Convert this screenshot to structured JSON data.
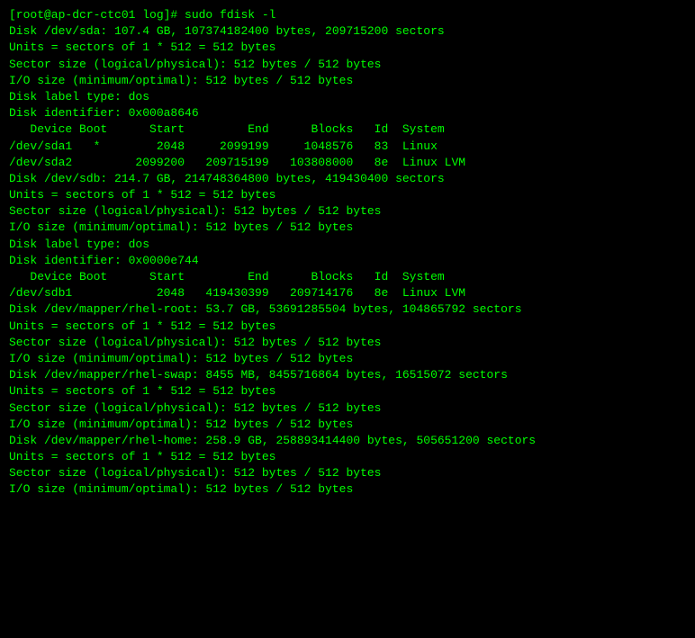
{
  "terminal": {
    "prompt": "[root@ap-dcr-ctc01 log]# sudo fdisk -l",
    "content": [
      "",
      "Disk /dev/sda: 107.4 GB, 107374182400 bytes, 209715200 sectors",
      "Units = sectors of 1 * 512 = 512 bytes",
      "Sector size (logical/physical): 512 bytes / 512 bytes",
      "I/O size (minimum/optimal): 512 bytes / 512 bytes",
      "Disk label type: dos",
      "Disk identifier: 0x000a8646",
      "",
      "   Device Boot      Start         End      Blocks   Id  System",
      "/dev/sda1   *        2048     2099199     1048576   83  Linux",
      "/dev/sda2         2099200   209715199   103808000   8e  Linux LVM",
      "",
      "Disk /dev/sdb: 214.7 GB, 214748364800 bytes, 419430400 sectors",
      "Units = sectors of 1 * 512 = 512 bytes",
      "Sector size (logical/physical): 512 bytes / 512 bytes",
      "I/O size (minimum/optimal): 512 bytes / 512 bytes",
      "Disk label type: dos",
      "Disk identifier: 0x0000e744",
      "",
      "   Device Boot      Start         End      Blocks   Id  System",
      "/dev/sdb1            2048   419430399   209714176   8e  Linux LVM",
      "",
      "Disk /dev/mapper/rhel-root: 53.7 GB, 53691285504 bytes, 104865792 sectors",
      "Units = sectors of 1 * 512 = 512 bytes",
      "Sector size (logical/physical): 512 bytes / 512 bytes",
      "I/O size (minimum/optimal): 512 bytes / 512 bytes",
      "",
      "",
      "Disk /dev/mapper/rhel-swap: 8455 MB, 8455716864 bytes, 16515072 sectors",
      "Units = sectors of 1 * 512 = 512 bytes",
      "Sector size (logical/physical): 512 bytes / 512 bytes",
      "I/O size (minimum/optimal): 512 bytes / 512 bytes",
      "",
      "",
      "Disk /dev/mapper/rhel-home: 258.9 GB, 258893414400 bytes, 505651200 sectors",
      "Units = sectors of 1 * 512 = 512 bytes",
      "Sector size (logical/physical): 512 bytes / 512 bytes",
      "I/O size (minimum/optimal): 512 bytes / 512 bytes"
    ]
  }
}
